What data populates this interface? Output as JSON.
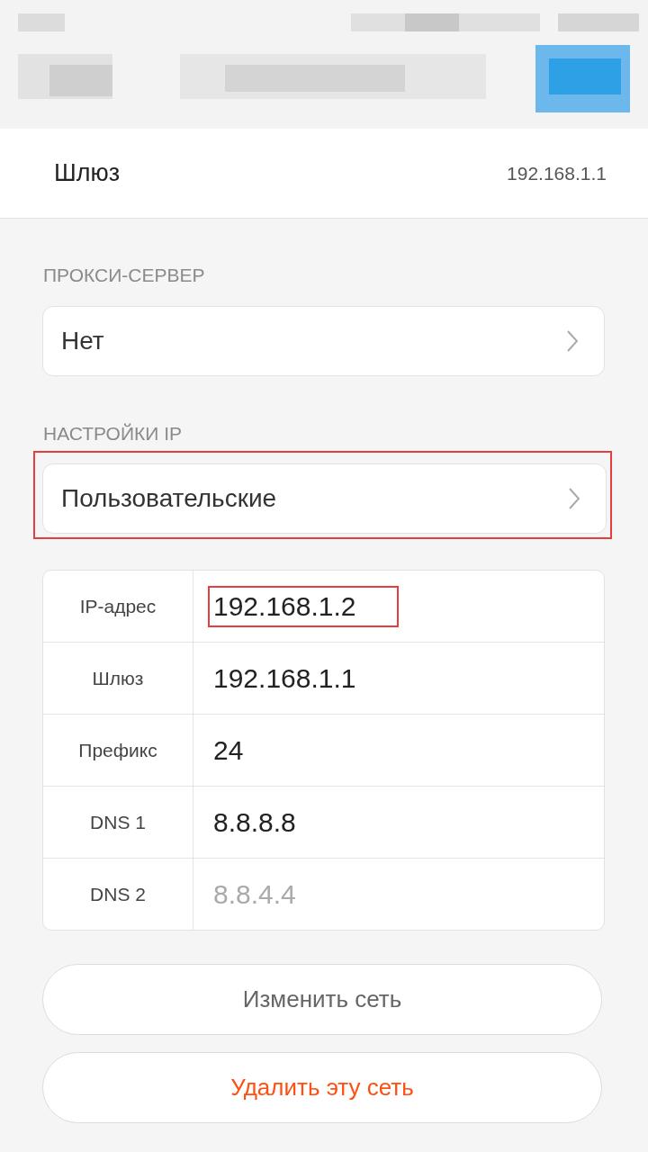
{
  "gateway_row": {
    "label": "Шлюз",
    "value": "192.168.1.1"
  },
  "proxy": {
    "heading": "ПРОКСИ-СЕРВЕР",
    "value": "Нет",
    "highlighted": false
  },
  "ip_settings": {
    "heading": "НАСТРОЙКИ IP",
    "value": "Пользовательские",
    "highlighted": true
  },
  "fields": [
    {
      "label": "IP-адрес",
      "value": "192.168.1.2",
      "highlighted": true
    },
    {
      "label": "Шлюз",
      "value": "192.168.1.1",
      "highlighted": false
    },
    {
      "label": "Префикс",
      "value": "24",
      "highlighted": false
    },
    {
      "label": "DNS 1",
      "value": "8.8.8.8",
      "highlighted": false
    },
    {
      "label": "DNS 2",
      "placeholder": "8.8.4.4",
      "highlighted": false
    }
  ],
  "buttons": [
    {
      "label": "Изменить сеть",
      "kind": "normal"
    },
    {
      "label": "Удалить эту сеть",
      "kind": "danger"
    }
  ]
}
